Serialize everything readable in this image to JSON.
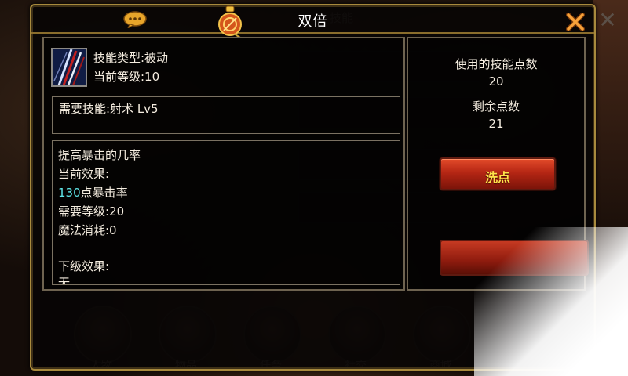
{
  "dialog": {
    "title": "双倍",
    "icons": {
      "chat": "chat-bubble-icon",
      "bag": "potion-bag-icon",
      "close": "close-x-icon"
    }
  },
  "skill": {
    "icon": "sword-strike-skill-icon",
    "type_line": "技能类型:被动",
    "level_line": "当前等级:10",
    "required_skill": "需要技能:射术 Lv5",
    "description": "提高暴击的几率",
    "current_effect_label": "当前效果:",
    "effect_value": "130",
    "effect_suffix": "点暴击率",
    "required_level": "需要等级:20",
    "mana_cost": "魔法消耗:0",
    "next_effect_label": "下级效果:",
    "next_effect_partial": "无"
  },
  "points": {
    "used_label": "使用的技能点数",
    "used_value": "20",
    "remaining_label": "剩余点数",
    "remaining_value": "21",
    "reset_button": "洗点"
  },
  "background": {
    "nav": [
      "人物",
      "物品",
      "任务",
      "社交",
      "商城"
    ],
    "header_partial": "技能"
  },
  "colors": {
    "frame_gold": "#a88a3d",
    "effect_highlight": "#5fe6e8",
    "button_red": "#b52614",
    "button_text": "#ffe24a"
  }
}
